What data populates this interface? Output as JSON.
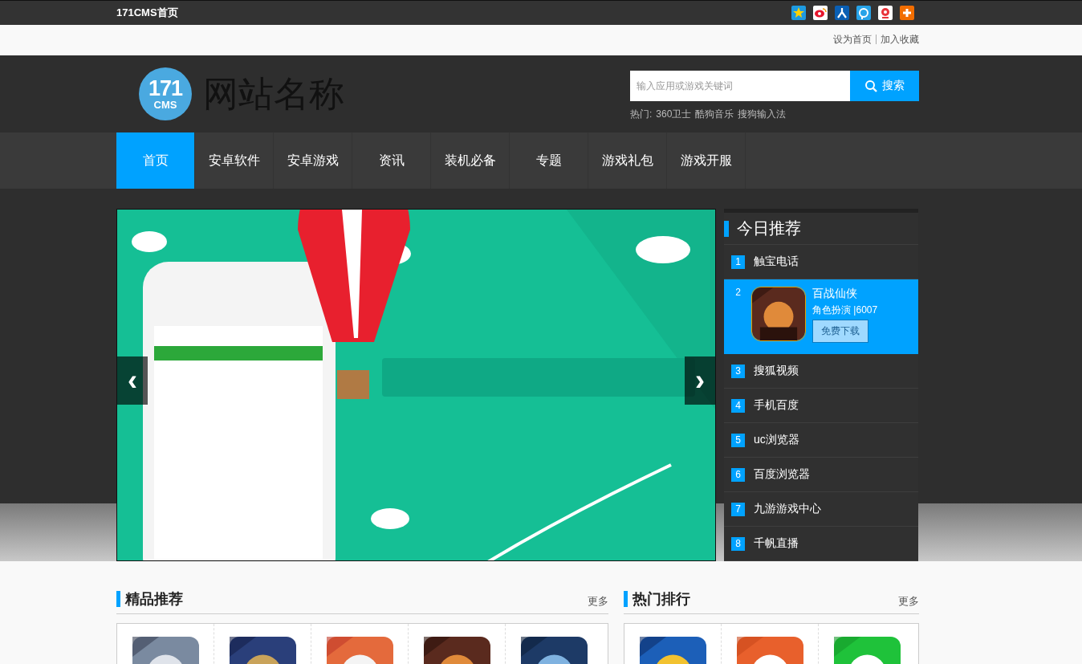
{
  "top_bar": {
    "home_link": "171CMS首页"
  },
  "util_links": [
    "设为首页",
    "加入收藏"
  ],
  "header": {
    "logo": {
      "number": "171",
      "word": "CMS"
    },
    "site_name": "网站名称",
    "search": {
      "placeholder": "输入应用或游戏关键词",
      "button": "搜索"
    },
    "hot_label": "热门:",
    "hot_keywords": [
      "360卫士",
      "酷狗音乐",
      "搜狗输入法"
    ]
  },
  "nav": [
    {
      "label": "首页",
      "selected": true
    },
    {
      "label": "安卓软件",
      "selected": false
    },
    {
      "label": "安卓游戏",
      "selected": false
    },
    {
      "label": "资讯",
      "selected": false
    },
    {
      "label": "装机必备",
      "selected": false
    },
    {
      "label": "专题",
      "selected": false
    },
    {
      "label": "游戏礼包",
      "selected": false
    },
    {
      "label": "游戏开服",
      "selected": false
    }
  ],
  "banner": {
    "kind": "picture",
    "prev": "‹",
    "next": "›"
  },
  "today": {
    "title": "今日推荐",
    "items": [
      {
        "kind": "plain",
        "rank": "1",
        "name": "触宝电话"
      },
      {
        "kind": "featured",
        "rank": "2",
        "name": "百战仙侠",
        "meta": "角色扮演 |6007",
        "button": "免费下载"
      },
      {
        "kind": "plain",
        "rank": "3",
        "name": "搜狐视频"
      },
      {
        "kind": "plain",
        "rank": "4",
        "name": "手机百度"
      },
      {
        "kind": "plain",
        "rank": "5",
        "name": "uc浏览器"
      },
      {
        "kind": "plain",
        "rank": "6",
        "name": "百度浏览器"
      },
      {
        "kind": "plain",
        "rank": "7",
        "name": "九游游戏中心"
      },
      {
        "kind": "plain",
        "rank": "8",
        "name": "千帆直播"
      }
    ]
  },
  "sections": [
    {
      "title": "精品推荐",
      "more": "更多"
    },
    {
      "title": "热门排行",
      "more": "更多"
    }
  ]
}
